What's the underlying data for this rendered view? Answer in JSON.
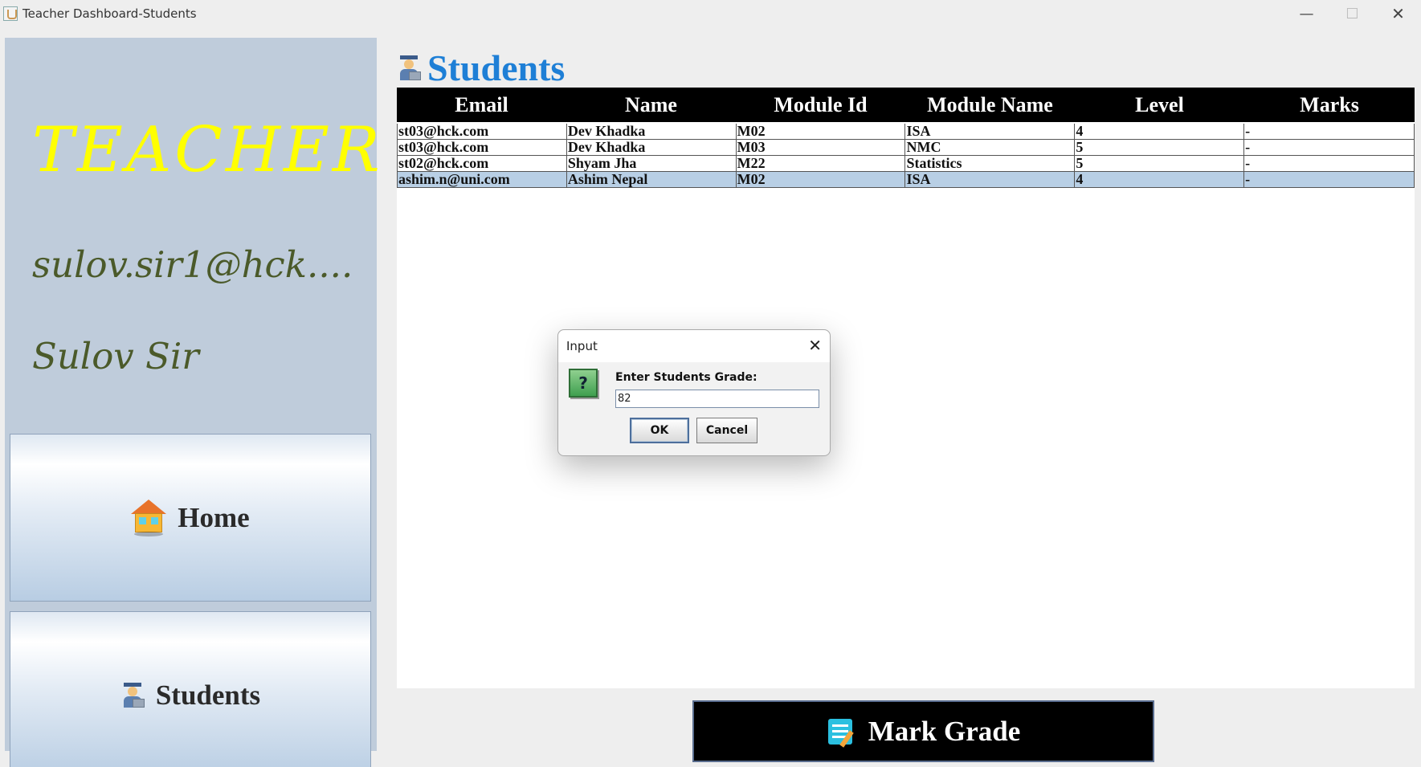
{
  "window": {
    "title": "Teacher Dashboard-Students",
    "minimize_glyph": "—",
    "maximize_glyph": "☐",
    "close_glyph": "✕"
  },
  "sidebar": {
    "role": "TEACHER",
    "email": "sulov.sir1@hck....",
    "name": "Sulov Sir",
    "nav": [
      {
        "label": "Home",
        "icon": "house-icon"
      },
      {
        "label": "Students",
        "icon": "student-icon"
      }
    ]
  },
  "main": {
    "title": "Students",
    "title_icon": "student-icon",
    "table": {
      "columns": [
        "Email",
        "Name",
        "Module Id",
        "Module Name",
        "Level",
        "Marks"
      ],
      "rows": [
        [
          "st03@hck.com",
          "Dev Khadka",
          "M02",
          "ISA",
          "4",
          "-"
        ],
        [
          "st03@hck.com",
          "Dev Khadka",
          "M03",
          "NMC",
          "5",
          "-"
        ],
        [
          "st02@hck.com",
          "Shyam Jha",
          "M22",
          "Statistics",
          "5",
          "-"
        ],
        [
          "ashim.n@uni.com",
          "Ashim Nepal",
          "M02",
          "ISA",
          "4",
          "-"
        ]
      ],
      "selected_row": 3
    },
    "mark_grade_label": "Mark Grade",
    "mark_grade_icon": "notepad-icon"
  },
  "dialog": {
    "title": "Input",
    "close_glyph": "✕",
    "icon_glyph": "?",
    "prompt": "Enter Students Grade:",
    "input_value": "82",
    "ok_label": "OK",
    "cancel_label": "Cancel"
  },
  "colors": {
    "accent_title": "#1e7fd6",
    "role_yellow": "#ffff00",
    "sidebar_bg": "#bfccdb",
    "user_text": "#4b5a2a",
    "selected_row": "#b8cfe5"
  }
}
